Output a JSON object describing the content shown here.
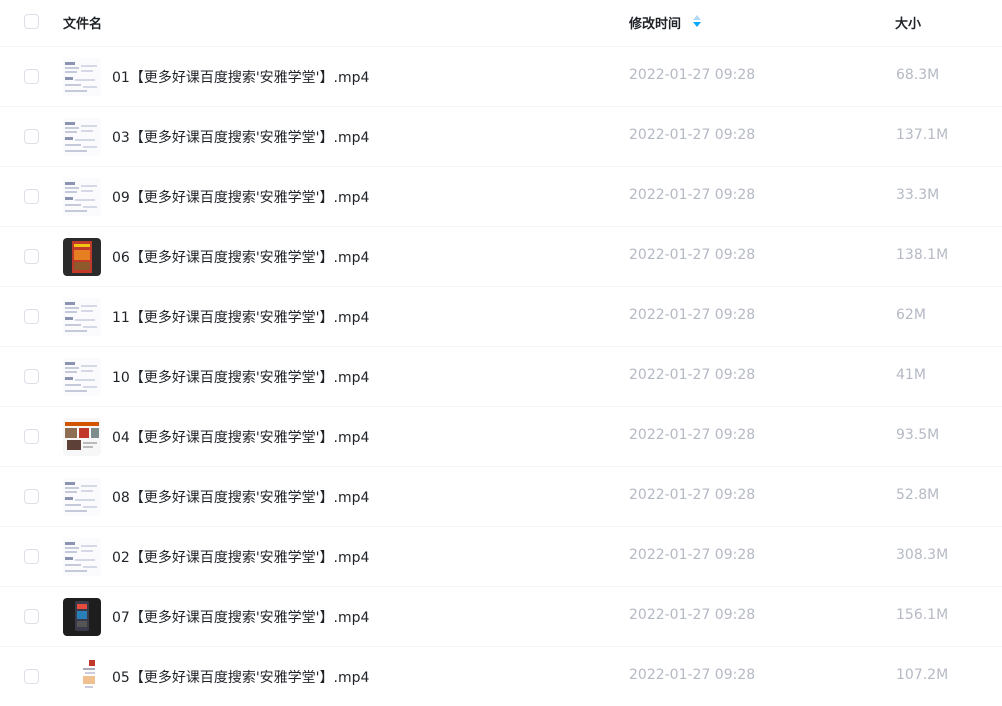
{
  "header": {
    "name_label": "文件名",
    "time_label": "修改时间",
    "size_label": "大小"
  },
  "colors": {
    "sort_arrow": "#06a7ff",
    "muted_text": "#b4b9c4",
    "primary_text": "#1f2328"
  },
  "files": [
    {
      "name": "01【更多好课百度搜索'安雅学堂'】.mp4",
      "modified": "2022-01-27 09:28",
      "size": "68.3M",
      "thumb": "doc"
    },
    {
      "name": "03【更多好课百度搜索'安雅学堂'】.mp4",
      "modified": "2022-01-27 09:28",
      "size": "137.1M",
      "thumb": "doc"
    },
    {
      "name": "09【更多好课百度搜索'安雅学堂'】.mp4",
      "modified": "2022-01-27 09:28",
      "size": "33.3M",
      "thumb": "doc"
    },
    {
      "name": "06【更多好课百度搜索'安雅学堂'】.mp4",
      "modified": "2022-01-27 09:28",
      "size": "138.1M",
      "thumb": "dark"
    },
    {
      "name": "11【更多好课百度搜索'安雅学堂'】.mp4",
      "modified": "2022-01-27 09:28",
      "size": "62M",
      "thumb": "doc"
    },
    {
      "name": "10【更多好课百度搜索'安雅学堂'】.mp4",
      "modified": "2022-01-27 09:28",
      "size": "41M",
      "thumb": "doc"
    },
    {
      "name": "04【更多好课百度搜索'安雅学堂'】.mp4",
      "modified": "2022-01-27 09:28",
      "size": "93.5M",
      "thumb": "photo"
    },
    {
      "name": "08【更多好课百度搜索'安雅学堂'】.mp4",
      "modified": "2022-01-27 09:28",
      "size": "52.8M",
      "thumb": "doc"
    },
    {
      "name": "02【更多好课百度搜索'安雅学堂'】.mp4",
      "modified": "2022-01-27 09:28",
      "size": "308.3M",
      "thumb": "doc"
    },
    {
      "name": "07【更多好课百度搜索'安雅学堂'】.mp4",
      "modified": "2022-01-27 09:28",
      "size": "156.1M",
      "thumb": "dark-phone"
    },
    {
      "name": "05【更多好课百度搜索'安雅学堂'】.mp4",
      "modified": "2022-01-27 09:28",
      "size": "107.2M",
      "thumb": "doc-small"
    }
  ]
}
